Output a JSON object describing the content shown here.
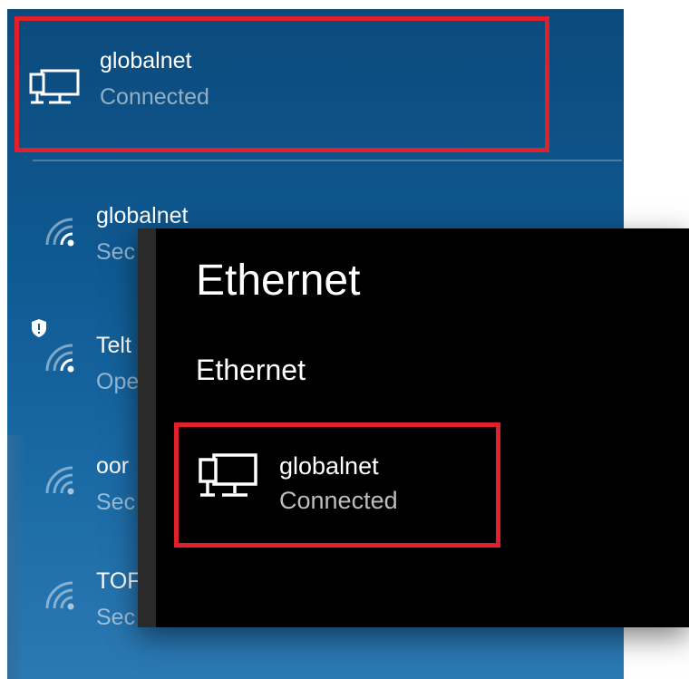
{
  "flyout": {
    "connected_network": {
      "name": "globalnet",
      "status": "Connected",
      "icon": "ethernet-monitor-icon"
    },
    "wifi_networks": [
      {
        "name": "globalnet",
        "status": "Sec",
        "icon": "wifi-icon"
      },
      {
        "name": "Telt",
        "status": "Ope",
        "icon": "wifi-icon",
        "badge": "shield-icon"
      },
      {
        "name": "oor",
        "status": "Sec",
        "icon": "wifi-icon"
      },
      {
        "name": "TOF",
        "status": "Sec",
        "icon": "wifi-icon"
      }
    ]
  },
  "ethernet_panel": {
    "title": "Ethernet",
    "section": "Ethernet",
    "network": {
      "name": "globalnet",
      "status": "Connected",
      "icon": "ethernet-monitor-icon"
    }
  },
  "colors": {
    "highlight": "#e0202a",
    "flyout_bg": "#0f5a93",
    "panel_bg": "#000000"
  }
}
